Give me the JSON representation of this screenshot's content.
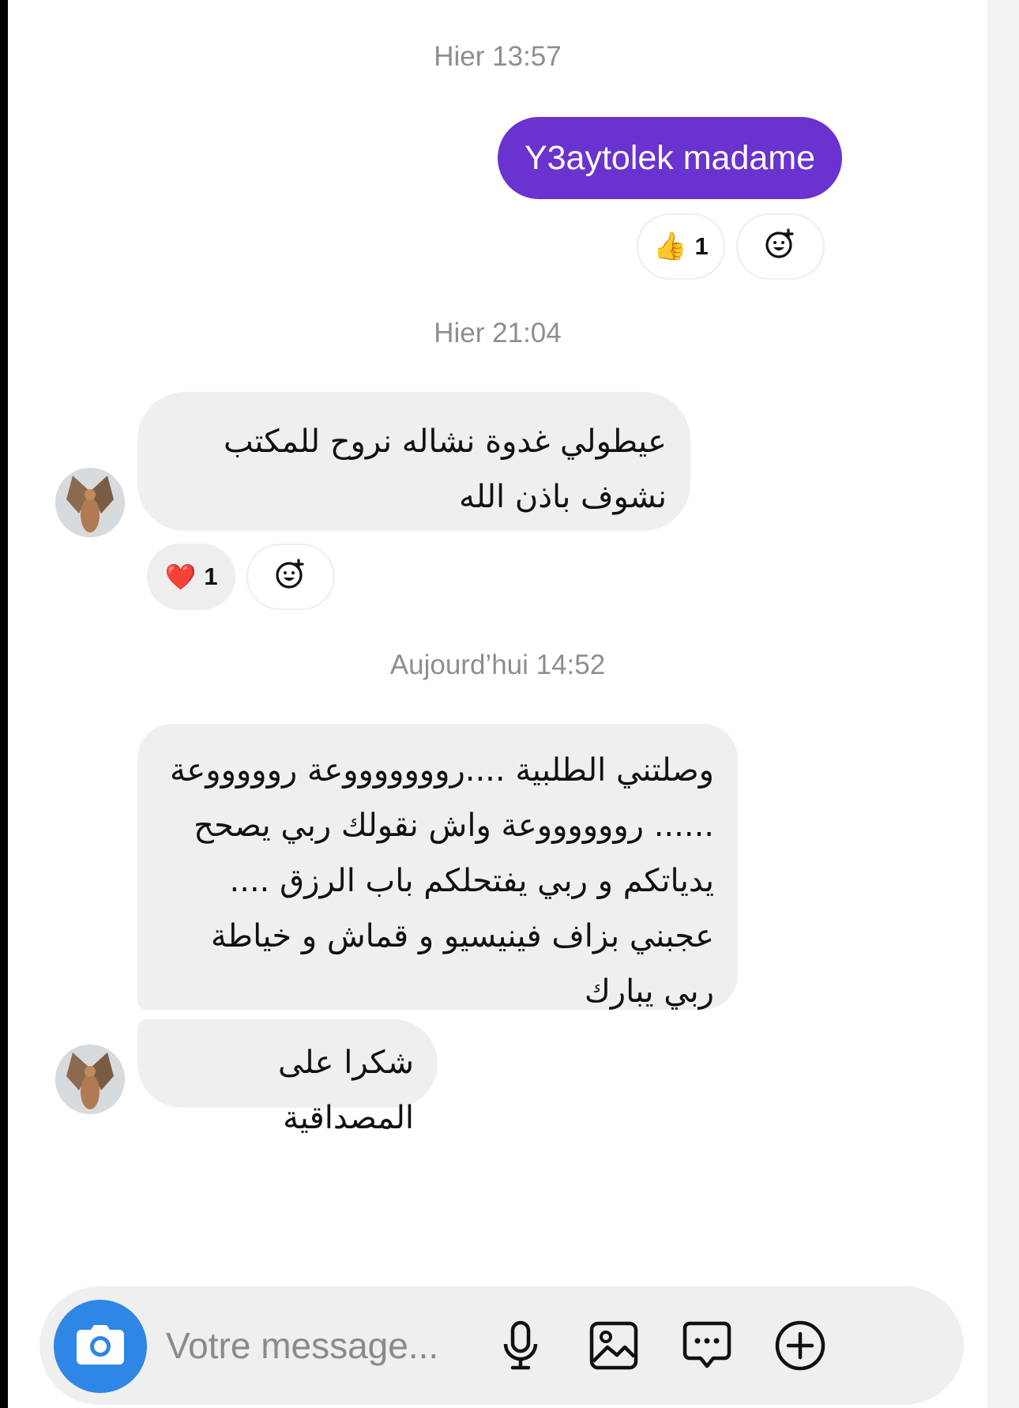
{
  "conversation": {
    "stamps": [
      "Hier 13:57",
      "Hier 21:04",
      "Aujourd’hui 14:52"
    ],
    "messages": [
      {
        "text": "Y3aytolek madame",
        "reaction_emoji": "👍",
        "reaction_count": "1"
      },
      {
        "text": "عيطولي غدوة نشاله نروح للمكتب نشوف باذن الله",
        "reaction_emoji": "❤️",
        "reaction_count": "1"
      },
      {
        "text": "وصلتني الطلبية ....روووووووعة روووووعة ...... رووووووعة واش نقولك ربي يصحح يدياتكم و ربي يفتحلكم باب الرزق .... عجبني بزاف فينيسيو و قماش و خياطة ربي يبارك"
      },
      {
        "text": "شكرا على المصداقية"
      }
    ]
  },
  "composer": {
    "placeholder": "Votre message..."
  },
  "icons": {
    "add_reaction": "add-reaction-icon",
    "camera": "camera-icon",
    "microphone": "microphone-icon",
    "gallery": "image-icon",
    "sticker": "chat-dots-icon",
    "more": "plus-circle-icon"
  },
  "colors": {
    "outgoing_bubble": "#6a32cf",
    "incoming_bubble": "#efefef",
    "camera_button": "#2e86e6",
    "timestamp": "#8e8e8e"
  }
}
